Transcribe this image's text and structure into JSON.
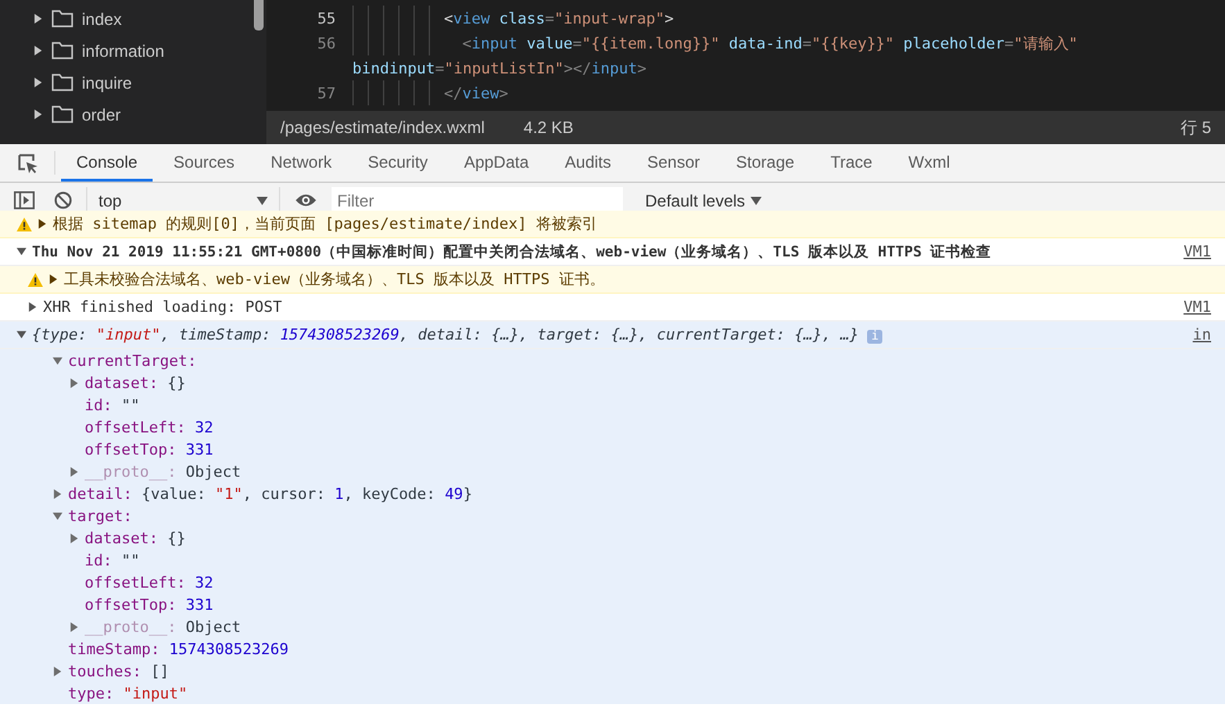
{
  "file_tree": {
    "items": [
      {
        "name": "index",
        "expanded": false
      },
      {
        "name": "information",
        "expanded": false
      },
      {
        "name": "inquire",
        "expanded": false
      },
      {
        "name": "order",
        "expanded": false
      }
    ]
  },
  "editor": {
    "lines": [
      {
        "number": "55",
        "current": true,
        "tokens": [
          {
            "text": "<",
            "kind": "bracket"
          },
          {
            "text": "view",
            "kind": "tag"
          },
          {
            "text": " class",
            "kind": "attr"
          },
          {
            "text": "=",
            "kind": "punct"
          },
          {
            "text": "\"input-wrap\"",
            "kind": "string"
          },
          {
            "text": ">",
            "kind": "bracket"
          }
        ]
      },
      {
        "number": "56",
        "current": false,
        "tokens": [
          {
            "text": "  <",
            "kind": "punct"
          },
          {
            "text": "input",
            "kind": "tag"
          },
          {
            "text": " value",
            "kind": "attr"
          },
          {
            "text": "=",
            "kind": "punct"
          },
          {
            "text": "\"{{item.long}}\"",
            "kind": "string"
          },
          {
            "text": " data-ind",
            "kind": "attr"
          },
          {
            "text": "=",
            "kind": "punct"
          },
          {
            "text": "\"{{key}}\"",
            "kind": "string"
          },
          {
            "text": " placeholder",
            "kind": "attr"
          },
          {
            "text": "=",
            "kind": "punct"
          },
          {
            "text": "\"请输入\"",
            "kind": "string"
          }
        ],
        "wrap": [
          {
            "text": "bindinput",
            "kind": "attr"
          },
          {
            "text": "=",
            "kind": "punct"
          },
          {
            "text": "\"inputListIn\"",
            "kind": "string"
          },
          {
            "text": "></",
            "kind": "punct"
          },
          {
            "text": "input",
            "kind": "tag"
          },
          {
            "text": ">",
            "kind": "punct"
          }
        ]
      },
      {
        "number": "57",
        "current": false,
        "tokens": [
          {
            "text": "</",
            "kind": "punct"
          },
          {
            "text": "view",
            "kind": "tag"
          },
          {
            "text": ">",
            "kind": "punct"
          }
        ]
      }
    ]
  },
  "status_bar": {
    "path": "/pages/estimate/index.wxml",
    "size": "4.2 KB",
    "position": "行 5"
  },
  "devtools": {
    "tabs": [
      {
        "label": "Console",
        "selected": true
      },
      {
        "label": "Sources",
        "selected": false
      },
      {
        "label": "Network",
        "selected": false
      },
      {
        "label": "Security",
        "selected": false
      },
      {
        "label": "AppData",
        "selected": false
      },
      {
        "label": "Audits",
        "selected": false
      },
      {
        "label": "Sensor",
        "selected": false
      },
      {
        "label": "Storage",
        "selected": false
      },
      {
        "label": "Trace",
        "selected": false
      },
      {
        "label": "Wxml",
        "selected": false
      }
    ],
    "toolbar": {
      "context": "top",
      "filter_placeholder": "Filter",
      "levels": "Default levels"
    }
  },
  "console": {
    "messages": [
      {
        "kind": "warning",
        "expanded": false,
        "text": "根据 sitemap 的规则[0]，当前页面 [pages/estimate/index] 将被索引"
      },
      {
        "kind": "group",
        "expanded": true,
        "text": "Thu Nov 21 2019 11:55:21 GMT+0800（中国标准时间）配置中关闭合法域名、web-view（业务域名）、TLS 版本以及 HTTPS 证书检查",
        "source": "VM1",
        "children": [
          {
            "kind": "warning",
            "expanded": false,
            "text": "工具未校验合法域名、web-view（业务域名）、TLS 版本以及 HTTPS 证书。"
          },
          {
            "kind": "log",
            "expanded": false,
            "text": "XHR finished loading: POST",
            "source": "VM1"
          }
        ]
      },
      {
        "kind": "object",
        "expanded": true,
        "source": "in",
        "summary": [
          {
            "text": "{type: ",
            "kind": "plain"
          },
          {
            "text": "\"input\"",
            "kind": "string"
          },
          {
            "text": ", timeStamp: ",
            "kind": "plain"
          },
          {
            "text": "1574308523269",
            "kind": "number"
          },
          {
            "text": ", detail: {…}, target: {…}, currentTarget: {…}, …}",
            "kind": "plain"
          }
        ],
        "badge": "i",
        "properties": [
          {
            "key": "currentTarget:",
            "expanded": true,
            "children": [
              {
                "key": "dataset:",
                "value": "{}",
                "kind": "plain",
                "expanded": false
              },
              {
                "key": "id:",
                "value": "\"\"",
                "kind": "plain"
              },
              {
                "key": "offsetLeft:",
                "value": "32",
                "kind": "number"
              },
              {
                "key": "offsetTop:",
                "value": "331",
                "kind": "number"
              },
              {
                "key": "__proto__:",
                "value": "Object",
                "kind": "plain",
                "expanded": false,
                "faded": true
              }
            ]
          },
          {
            "key": "detail:",
            "expanded": false,
            "value_tokens": [
              {
                "text": "{value: ",
                "kind": "plain"
              },
              {
                "text": "\"1\"",
                "kind": "string"
              },
              {
                "text": ", cursor: ",
                "kind": "plain"
              },
              {
                "text": "1",
                "kind": "number"
              },
              {
                "text": ", keyCode: ",
                "kind": "plain"
              },
              {
                "text": "49",
                "kind": "number"
              },
              {
                "text": "}",
                "kind": "plain"
              }
            ]
          },
          {
            "key": "target:",
            "expanded": true,
            "children": [
              {
                "key": "dataset:",
                "value": "{}",
                "kind": "plain",
                "expanded": false
              },
              {
                "key": "id:",
                "value": "\"\"",
                "kind": "plain"
              },
              {
                "key": "offsetLeft:",
                "value": "32",
                "kind": "number"
              },
              {
                "key": "offsetTop:",
                "value": "331",
                "kind": "number"
              },
              {
                "key": "__proto__:",
                "value": "Object",
                "kind": "plain",
                "expanded": false,
                "faded": true
              }
            ]
          },
          {
            "key": "timeStamp:",
            "value": "1574308523269",
            "kind": "number"
          },
          {
            "key": "touches:",
            "value": "[]",
            "kind": "plain",
            "expanded": false
          },
          {
            "key": "type:",
            "value": "\"input\"",
            "kind": "string"
          }
        ]
      }
    ]
  }
}
